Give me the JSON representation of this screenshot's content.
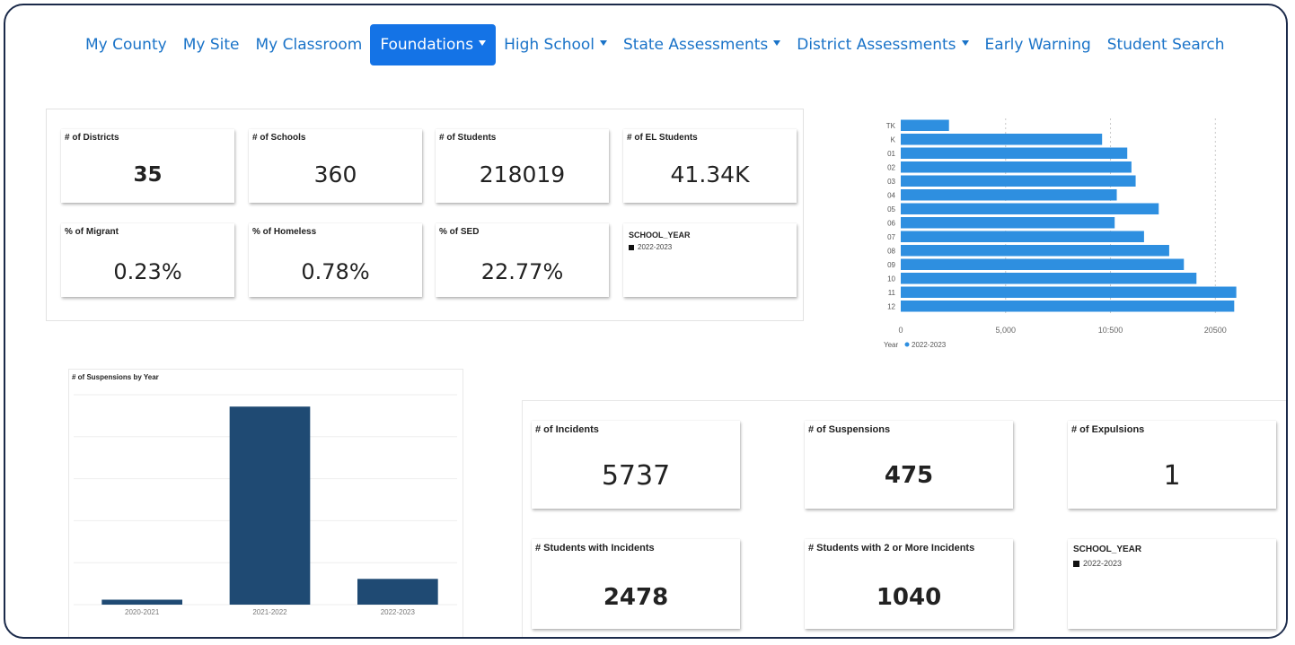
{
  "nav": {
    "items": [
      {
        "label": "My County",
        "dropdown": false,
        "active": false
      },
      {
        "label": "My Site",
        "dropdown": false,
        "active": false
      },
      {
        "label": "My Classroom",
        "dropdown": false,
        "active": false
      },
      {
        "label": "Foundations",
        "dropdown": true,
        "active": true
      },
      {
        "label": "High School",
        "dropdown": true,
        "active": false
      },
      {
        "label": "State Assessments",
        "dropdown": true,
        "active": false
      },
      {
        "label": "District Assessments",
        "dropdown": true,
        "active": false
      },
      {
        "label": "Early Warning",
        "dropdown": false,
        "active": false
      },
      {
        "label": "Student Search",
        "dropdown": false,
        "active": false
      }
    ]
  },
  "kpis": {
    "districts": {
      "label": "# of Districts",
      "value": "35"
    },
    "schools": {
      "label": "# of Schools",
      "value": "360"
    },
    "students": {
      "label": "# of Students",
      "value": "218019"
    },
    "el_students": {
      "label": "# of EL Students",
      "value": "41.34K"
    },
    "migrant": {
      "label": "% of Migrant",
      "value": "0.23%"
    },
    "homeless": {
      "label": "% of Homeless",
      "value": "0.78%"
    },
    "sed": {
      "label": "% of SED",
      "value": "22.77%"
    },
    "legend": {
      "title": "SCHOOL_YEAR",
      "entry": "2022-2023"
    }
  },
  "incidents": {
    "incidents": {
      "label": "# of Incidents",
      "value": "5737"
    },
    "suspensions": {
      "label": "# of Suspensions",
      "value": "475"
    },
    "expulsions": {
      "label": "# of Expulsions",
      "value": "1"
    },
    "students_with": {
      "label": "# Students with Incidents",
      "value": "2478"
    },
    "students_2plus": {
      "label": "# Students with 2 or More Incidents",
      "value": "1040"
    },
    "legend": {
      "title": "SCHOOL_YEAR",
      "entry": "2022-2023"
    }
  },
  "colors": {
    "accent": "#1473e6",
    "nav_text": "#1a73c8",
    "hbar": "#2e8fe0",
    "vbar": "#1f4a73"
  },
  "chart_data": [
    {
      "type": "bar",
      "orientation": "horizontal",
      "categories": [
        "TK",
        "K",
        "01",
        "02",
        "03",
        "04",
        "05",
        "06",
        "07",
        "08",
        "09",
        "10",
        "11",
        "12"
      ],
      "values": [
        2300,
        9600,
        10800,
        11000,
        11200,
        10300,
        12300,
        10200,
        11600,
        12800,
        13500,
        14100,
        16000,
        15900
      ],
      "xticks": [
        "0",
        "5,000",
        "10:500",
        "20500"
      ],
      "xlim": [
        0,
        16700
      ],
      "grid": true,
      "legend": {
        "title": "Year",
        "entries": [
          "2022-2023"
        ],
        "placement": "bottom-left"
      }
    },
    {
      "type": "bar",
      "title": "# of Suspensions by Year",
      "categories": [
        "2020-2021",
        "2021-2022",
        "2022-2023"
      ],
      "values": [
        25,
        1000,
        130
      ],
      "ylim": [
        0,
        1060
      ],
      "grid": true
    }
  ]
}
